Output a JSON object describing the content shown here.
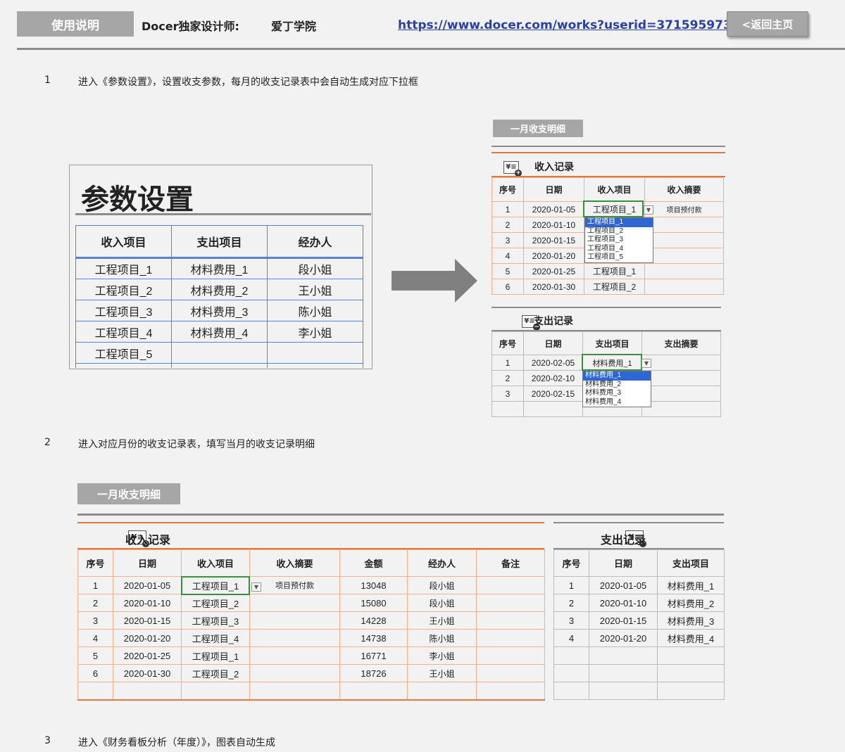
{
  "header": {
    "usage_btn": "使用说明",
    "designer_label": "Docer独家设计师:",
    "designer_name": "爱丁学院",
    "link": "https://www.docer.com/works?userid=371595973",
    "back_btn": "<返回主页"
  },
  "steps": [
    {
      "num": "1",
      "text": "进入《参数设置》，设置收支参数，每月的收支记录表中会自动生成对应下拉框"
    },
    {
      "num": "2",
      "text": "进入对应月份的收支记录表，填写当月的收支记录明细"
    },
    {
      "num": "3",
      "text": "进入《财务看板分析（年度）》，图表自动生成"
    }
  ],
  "param": {
    "title": "参数设置",
    "headers": [
      "收入项目",
      "支出项目",
      "经办人"
    ],
    "rows": [
      [
        "工程项目_1",
        "材料费用_1",
        "段小姐"
      ],
      [
        "工程项目_2",
        "材料费用_2",
        "王小姐"
      ],
      [
        "工程项目_3",
        "材料费用_3",
        "陈小姐"
      ],
      [
        "工程项目_4",
        "材料费用_4",
        "李小姐"
      ],
      [
        "工程项目_5",
        "",
        ""
      ]
    ]
  },
  "small": {
    "tab": "一月收支明细",
    "income_title": "收入记录",
    "income_headers": [
      "序号",
      "日期",
      "收入项目",
      "收入摘要"
    ],
    "income_rows": [
      [
        "1",
        "2020-01-05",
        "工程项目_1",
        "项目预付款"
      ],
      [
        "2",
        "2020-01-10",
        "",
        ""
      ],
      [
        "3",
        "2020-01-15",
        "",
        ""
      ],
      [
        "4",
        "2020-01-20",
        "",
        ""
      ],
      [
        "5",
        "2020-01-25",
        "工程项目_1",
        ""
      ],
      [
        "6",
        "2020-01-30",
        "工程项目_2",
        ""
      ]
    ],
    "income_dropdown": [
      "工程项目_1",
      "工程项目_2",
      "工程项目_3",
      "工程项目_4",
      "工程项目_5"
    ],
    "expense_title": "支出记录",
    "expense_headers": [
      "序号",
      "日期",
      "支出项目",
      "支出摘要"
    ],
    "expense_rows": [
      [
        "1",
        "2020-02-05",
        "材料费用_1",
        ""
      ],
      [
        "2",
        "2020-02-10",
        "",
        ""
      ],
      [
        "3",
        "2020-02-15",
        "",
        ""
      ]
    ],
    "expense_dropdown": [
      "材料费用_1",
      "材料费用_2",
      "材料费用_3",
      "材料费用_4"
    ]
  },
  "big": {
    "tab": "一月收支明细",
    "income_title": "收入记录",
    "income_headers": [
      "序号",
      "日期",
      "收入项目",
      "收入摘要",
      "金额",
      "经办人",
      "备注"
    ],
    "income_rows": [
      [
        "1",
        "2020-01-05",
        "工程项目_1",
        "项目预付款",
        "13048",
        "段小姐",
        ""
      ],
      [
        "2",
        "2020-01-10",
        "工程项目_2",
        "",
        "15080",
        "段小姐",
        ""
      ],
      [
        "3",
        "2020-01-15",
        "工程项目_3",
        "",
        "14228",
        "王小姐",
        ""
      ],
      [
        "4",
        "2020-01-20",
        "工程项目_4",
        "",
        "14738",
        "陈小姐",
        ""
      ],
      [
        "5",
        "2020-01-25",
        "工程项目_1",
        "",
        "16771",
        "李小姐",
        ""
      ],
      [
        "6",
        "2020-01-30",
        "工程项目_2",
        "",
        "18726",
        "王小姐",
        ""
      ]
    ],
    "expense_title": "支出记录",
    "expense_headers": [
      "序号",
      "日期",
      "支出项目"
    ],
    "expense_rows": [
      [
        "1",
        "2020-01-05",
        "材料费用_1"
      ],
      [
        "2",
        "2020-01-10",
        "材料费用_2"
      ],
      [
        "3",
        "2020-01-15",
        "材料费用_3"
      ],
      [
        "4",
        "2020-01-20",
        "材料费用_4"
      ]
    ]
  },
  "icons": {
    "yen_mark": "¥≡",
    "plus": "+",
    "minus": "−"
  },
  "colors": {
    "accent_orange": "#e2773a",
    "tab_gray": "#a6a6a6",
    "link_blue": "#2b3fa6",
    "param_border": "#5b7ed9",
    "select_blue": "#2f66d6"
  }
}
